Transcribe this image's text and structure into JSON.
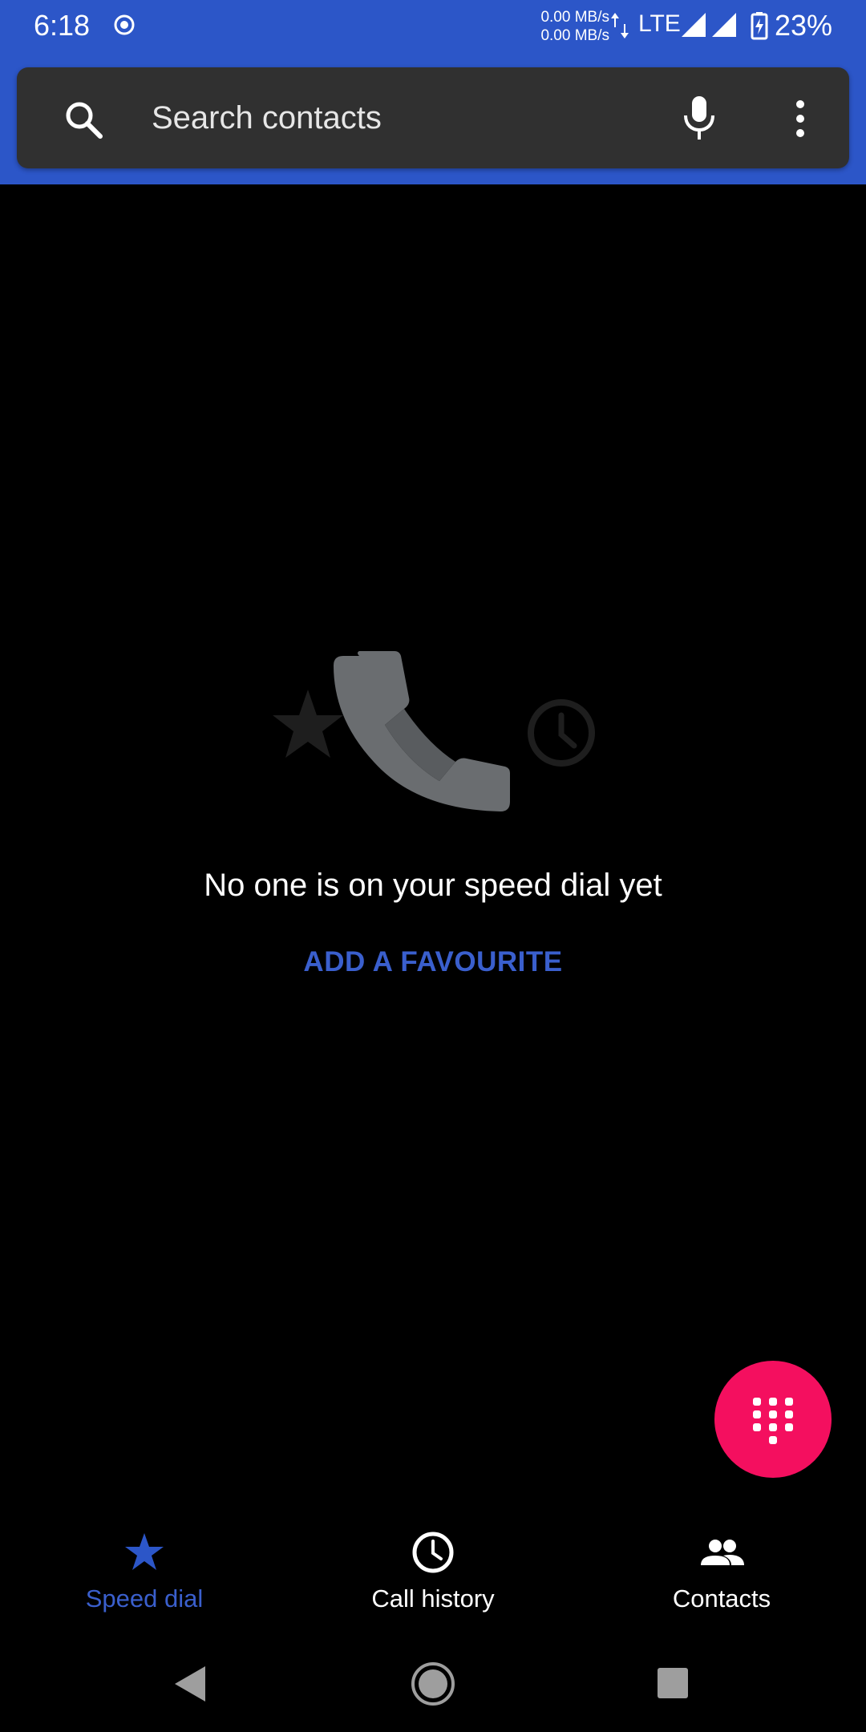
{
  "status_bar": {
    "time": "6:18",
    "net_up": "0.00 MB/s",
    "net_down": "0.00 MB/s",
    "network": "LTE",
    "battery": "23%"
  },
  "search": {
    "placeholder": "Search contacts",
    "icons": [
      "search-icon",
      "mic-icon",
      "more-vert-icon"
    ]
  },
  "empty_state": {
    "title": "No one is on your speed dial yet",
    "action": "ADD A FAVOURITE",
    "illustration_icons": [
      "star-icon",
      "phone-icon",
      "clock-icon"
    ]
  },
  "fab": {
    "icon": "dialpad-icon"
  },
  "bottom_nav": {
    "items": [
      {
        "label": "Speed dial",
        "icon": "star-icon",
        "selected": true
      },
      {
        "label": "Call history",
        "icon": "clock-icon",
        "selected": false
      },
      {
        "label": "Contacts",
        "icon": "people-icon",
        "selected": false
      }
    ]
  },
  "colors": {
    "accent": "#2c56c8",
    "selected_nav": "#3a5fcd",
    "fab": "#f40f5f",
    "background": "#000000",
    "search_bar": "#303030"
  }
}
